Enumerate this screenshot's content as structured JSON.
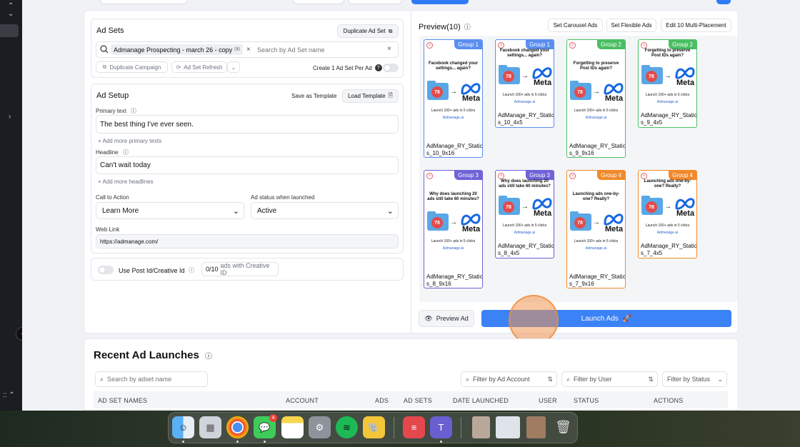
{
  "ad_sets": {
    "title": "Ad Sets",
    "duplicate_label": "Duplicate Ad Set",
    "selected_chip": "Admanage Prospecting - march 26 - copy",
    "chip_extra": "06",
    "search_placeholder": "Search by Ad Set name",
    "duplicate_campaign": "Duplicate Campaign",
    "refresh": "Ad Set Refresh",
    "create_one": "Create 1 Ad Set Per Ad"
  },
  "ad_setup": {
    "title": "Ad Setup",
    "save_template": "Save as Template",
    "load_template": "Load Template",
    "primary_label": "Primary text",
    "primary_value": "The best thing I've ever seen.",
    "add_primary": "+ Add more primary texts",
    "headline_label": "Headline",
    "headline_value": "Can't wait today",
    "add_headline": "+ Add more headlines",
    "cta_label": "Call to Action",
    "cta_value": "Learn More",
    "status_label": "Ad status when launched",
    "status_value": "Active",
    "weblink_label": "Web Link",
    "weblink_value": "https://admanage.com/"
  },
  "post_id": {
    "label": "Use Post Id/Creative Id",
    "count": "0",
    "count_total": "/10",
    "count_suffix": "ads with Creative ID"
  },
  "preview": {
    "title": "Preview(10)",
    "set_carousel": "Set Carousel Ads",
    "set_flexible": "Set Flexible Ads",
    "edit_multi": "Edit 10 Multi-Placement",
    "preview_ad": "Preview Ad",
    "launch": "Launch Ads",
    "ads": [
      {
        "group": "Group 1",
        "cls": "g1",
        "headline": "Facebook changed your settings... again?",
        "name1": "AdManage_RY_Static",
        "name2": "s_10_9x16"
      },
      {
        "group": "Group 1",
        "cls": "g1",
        "headline": "Facebook changed your settings... again?",
        "name1": "AdManage_RY_Static",
        "name2": "s_10_4x5"
      },
      {
        "group": "Group 2",
        "cls": "g2",
        "headline": "Forgetting to preserve Post IDs again?",
        "name1": "AdManage_RY_Static",
        "name2": "s_9_9x16"
      },
      {
        "group": "Group 2",
        "cls": "g2",
        "headline": "Forgetting to preserve Post IDs again?",
        "name1": "AdManage_RY_Static",
        "name2": "s_9_4x5"
      },
      {
        "group": "Group 3",
        "cls": "g3",
        "headline": "Why does launching 20 ads still take 60 minutes?",
        "name1": "AdManage_RY_Static",
        "name2": "s_8_9x16"
      },
      {
        "group": "Group 3",
        "cls": "g3",
        "headline": "Why does launching 20 ads still take 60 minutes?",
        "name1": "AdManage_RY_Static",
        "name2": "s_8_4x5"
      },
      {
        "group": "Group 4",
        "cls": "g4",
        "headline": "Launching ads one-by-one? Really?",
        "name1": "AdManage_RY_Static",
        "name2": "s_7_9x16"
      },
      {
        "group": "Group 4",
        "cls": "g4",
        "headline": "Launching ads one-by-one? Really?",
        "name1": "AdManage_RY_Static",
        "name2": "s_7_4x5"
      }
    ],
    "ad_badge": "78",
    "ad_meta": "Meta",
    "ad_sub": "Launch 100+ ads in 5 clicks",
    "ad_brand": "Admanage.ai"
  },
  "recent": {
    "title": "Recent Ad Launches",
    "search_placeholder": "Search by adset name",
    "filter_account": "Filter by Ad Account",
    "filter_user": "Filter by User",
    "filter_status": "Filter by Status",
    "columns": [
      "AD SET NAMES",
      "ACCOUNT",
      "ADS",
      "AD SETS",
      "DATE LAUNCHED",
      "USER",
      "STATUS",
      "ACTIONS"
    ]
  },
  "dock": {
    "messages_badge": "4",
    "apps": [
      "finder-icon",
      "launchpad-icon",
      "chrome-icon",
      "messages-icon",
      "notes-icon",
      "system-settings-icon",
      "spotify-icon",
      "cyberduck-icon",
      "admanage-icon",
      "teams-icon"
    ]
  },
  "colors": {
    "accent": "#3b82f6",
    "group1": "#5b8ef0",
    "group2": "#4bbf63",
    "group3": "#6f63d8",
    "group4": "#f08a2c"
  }
}
